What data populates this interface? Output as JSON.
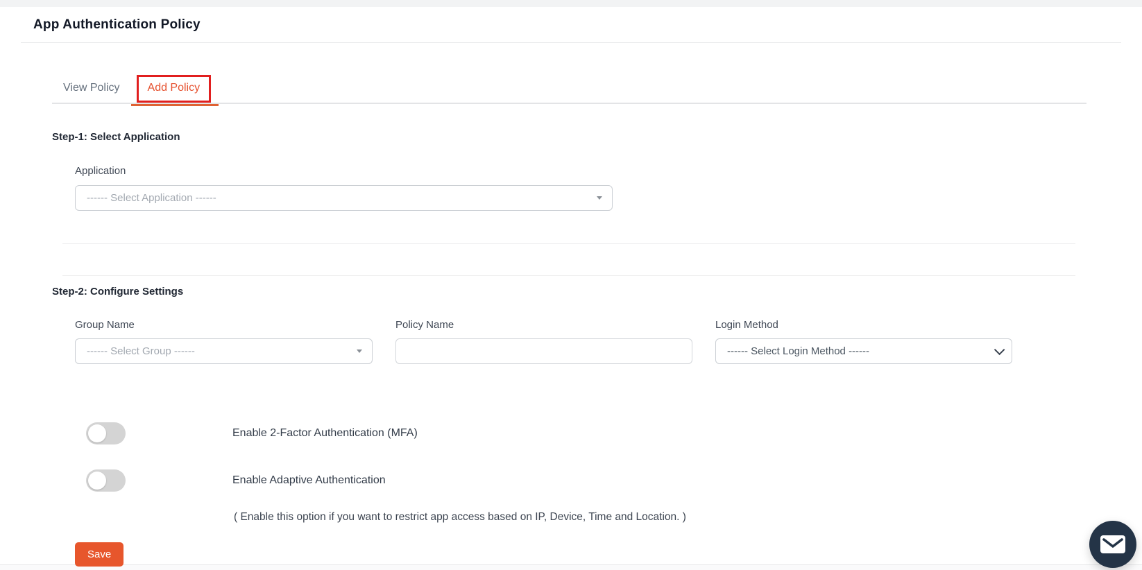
{
  "page": {
    "title": "App Authentication Policy"
  },
  "tabs": [
    {
      "label": "View Policy",
      "active": false
    },
    {
      "label": "Add Policy",
      "active": true,
      "annotation": "red-highlight-box"
    }
  ],
  "step1": {
    "heading": "Step-1: Select Application",
    "application": {
      "label": "Application",
      "placeholder": "------ Select Application ------"
    }
  },
  "step2": {
    "heading": "Step-2: Configure Settings",
    "group": {
      "label": "Group Name",
      "placeholder": "------ Select Group ------"
    },
    "policy": {
      "label": "Policy Name",
      "value": ""
    },
    "login": {
      "label": "Login Method",
      "placeholder": "------ Select Login Method ------"
    },
    "mfa_toggle": {
      "label": "Enable 2-Factor Authentication (MFA)",
      "enabled": false
    },
    "adaptive_toggle": {
      "label": "Enable Adaptive Authentication",
      "enabled": false,
      "note": "( Enable this option if you want to restrict app access based on IP, Device, Time and Location. )"
    },
    "save_label": "Save"
  },
  "icons": {
    "dropdown_arrow": "select2-triangle-down",
    "chevron_down": "native-select-chevron",
    "chat": "envelope-icon"
  },
  "colors": {
    "save_button_bg": "#e7562c",
    "tab_active_text": "#e6512f",
    "annotation_box": "#e11f1f",
    "active_tab_underline": "#df6234",
    "chat_button_bg": "#243447",
    "toggle_off_track": "#d4d4d4",
    "placeholder_text": "#a2a8b0"
  }
}
